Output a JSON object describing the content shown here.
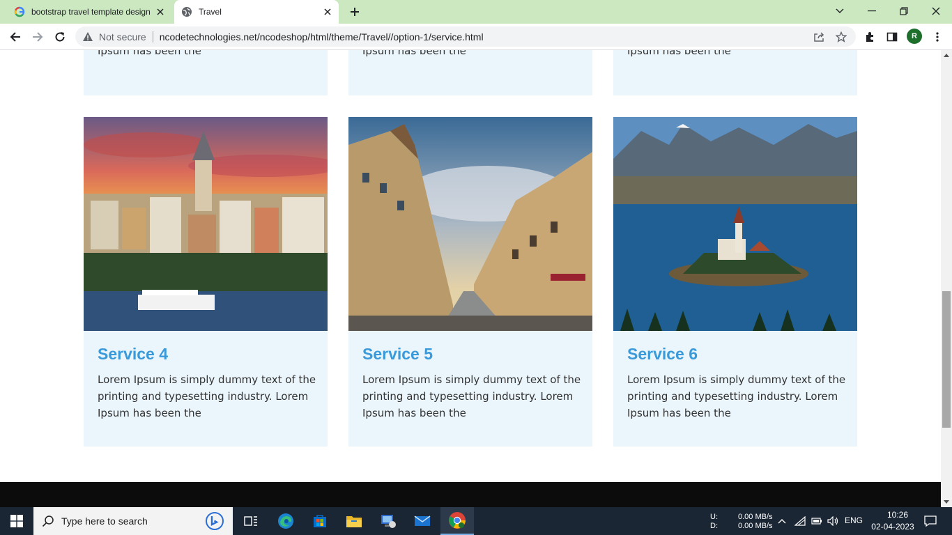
{
  "browser": {
    "tabs": [
      {
        "title": "bootstrap travel template design"
      },
      {
        "title": "Travel"
      }
    ],
    "security_label": "Not secure",
    "url": "ncodetechnologies.net/ncodeshop/html/theme/Travel//option-1/service.html",
    "profile_initial": "R"
  },
  "page": {
    "top_cards": [
      {
        "text": "Ipsum has been the"
      },
      {
        "text": "Ipsum has been the"
      },
      {
        "text": "Ipsum has been the"
      }
    ],
    "cards": [
      {
        "title": "Service 4",
        "text": "Lorem Ipsum is simply dummy text of the printing and typesetting industry. Lorem Ipsum has been the",
        "image": "istanbul-galata-tower-photo"
      },
      {
        "title": "Service 5",
        "text": "Lorem Ipsum is simply dummy text of the printing and typesetting industry. Lorem Ipsum has been the",
        "image": "city-street-buildings-photo"
      },
      {
        "title": "Service 6",
        "text": "Lorem Ipsum is simply dummy text of the printing and typesetting industry. Lorem Ipsum has been the",
        "image": "lake-island-church-photo"
      }
    ],
    "colors": {
      "card_bg": "#eaf5fc",
      "title": "#3a9ad9",
      "footer": "#0c0c0c"
    }
  },
  "taskbar": {
    "search_placeholder": "Type here to search",
    "net_up_label": "U:",
    "net_down_label": "D:",
    "net_up": "0.00 MB/s",
    "net_down": "0.00 MB/s",
    "language": "ENG",
    "time": "10:26",
    "date": "02-04-2023"
  }
}
